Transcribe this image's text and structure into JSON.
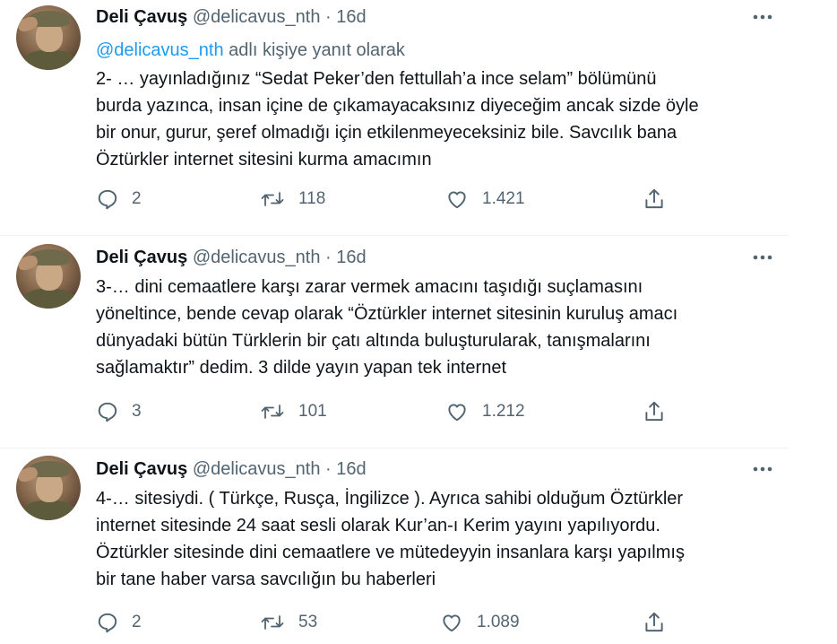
{
  "tweets": [
    {
      "name": "Deli Çavuş",
      "handle": "@delicavus_nth",
      "separator": "·",
      "time": "16d",
      "reply_mention": "@delicavus_nth",
      "reply_suffix": " adlı kişiye yanıt olarak",
      "lines": [
        "2- … yayınladığınız “Sedat Peker’den fettullah’a ince selam” bölümünü",
        "burda yazınca, insan içine de çıkamayacaksınız diyeceğim ancak sizde öyle",
        "bir onur, gurur, şeref olmadığı için etkilenmeyeceksiniz bile. Savcılık bana",
        "Öztürkler internet sitesini kurma amacımın"
      ],
      "replies": "2",
      "retweets": "118",
      "likes": "1.421"
    },
    {
      "name": "Deli Çavuş",
      "handle": "@delicavus_nth",
      "separator": "·",
      "time": "16d",
      "lines": [
        "3-… dini cemaatlere karşı zarar vermek amacını taşıdığı suçlamasını",
        "yöneltince, bende cevap olarak “Öztürkler internet sitesinin kuruluş amacı",
        "dünyadaki bütün Türklerin bir çatı altında buluşturularak, tanışmalarını",
        "sağlamaktır” dedim. 3 dilde yayın yapan tek internet"
      ],
      "replies": "3",
      "retweets": "101",
      "likes": "1.212"
    },
    {
      "name": "Deli Çavuş",
      "handle": "@delicavus_nth",
      "separator": "·",
      "time": "16d",
      "lines": [
        "4-… sitesiydi. ( Türkçe, Rusça, İngilizce ). Ayrıca sahibi olduğum Öztürkler",
        "internet sitesinde 24 saat sesli olarak Kur’an-ı Kerim yayını yapılıyordu.",
        "Öztürkler sitesinde dini cemaatlere ve mütedeyyin insanlara karşı yapılmış",
        "bir tane haber varsa savcılığın bu haberleri"
      ],
      "replies": "2",
      "retweets": "53",
      "likes": "1.089"
    }
  ],
  "icons": {
    "more": "more-icon",
    "reply": "reply-icon",
    "retweet": "retweet-icon",
    "like": "like-icon",
    "share": "share-icon"
  },
  "colors": {
    "text": "#0f1419",
    "secondary": "#536471",
    "link": "#1d9bf0",
    "divider": "#eff3f4"
  }
}
